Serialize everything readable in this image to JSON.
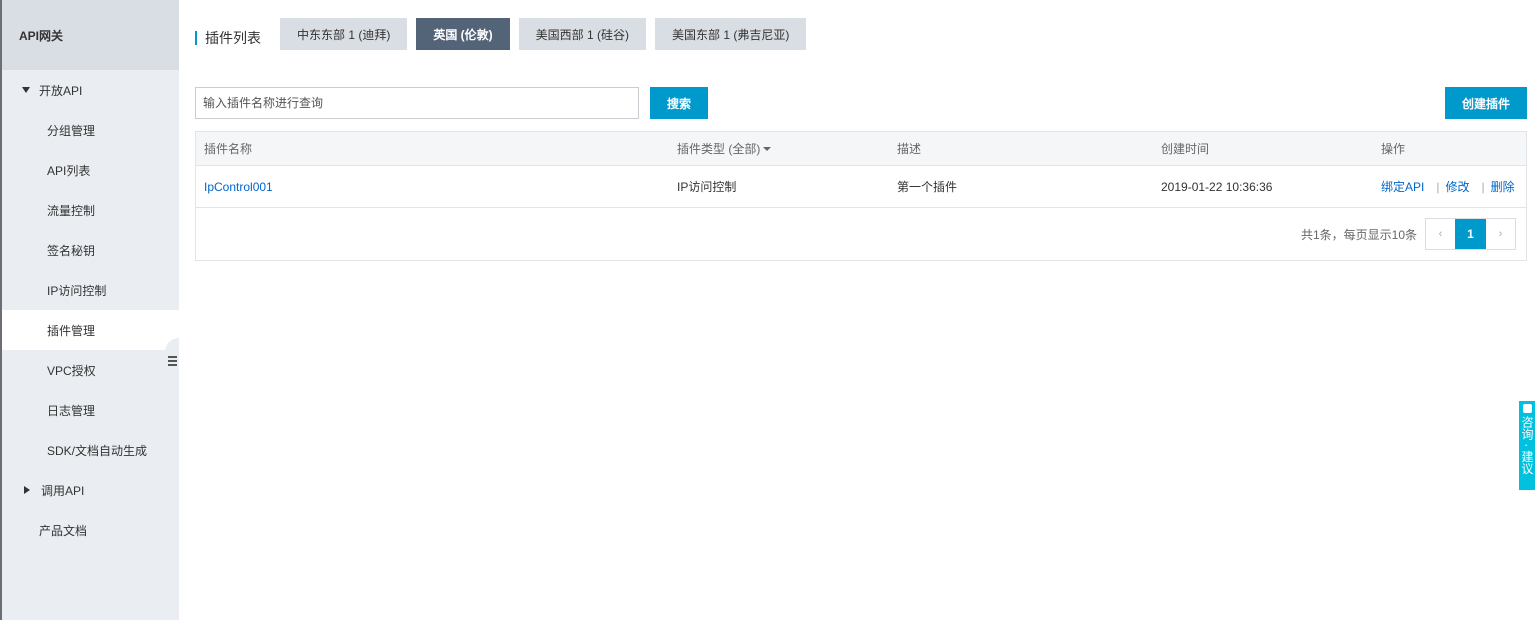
{
  "sidebar": {
    "title": "API网关",
    "section_open": "开放API",
    "items": [
      "分组管理",
      "API列表",
      "流量控制",
      "签名秘钥",
      "IP访问控制",
      "插件管理",
      "VPC授权",
      "日志管理",
      "SDK/文档自动生成"
    ],
    "active_item": "插件管理",
    "section_call": "调用API",
    "docs": "产品文档"
  },
  "page": {
    "title": "插件列表",
    "regions": [
      "中东东部 1 (迪拜)",
      "英国 (伦敦)",
      "美国西部 1 (硅谷)",
      "美国东部 1 (弗吉尼亚)"
    ],
    "active_region": "英国 (伦敦)"
  },
  "search": {
    "placeholder": "输入插件名称进行查询",
    "button": "搜索",
    "create_button": "创建插件"
  },
  "table": {
    "headers": [
      "插件名称",
      "插件类型 (全部)",
      "描述",
      "创建时间",
      "操作"
    ],
    "rows": [
      {
        "name": "IpControl001",
        "type": "IP访问控制",
        "description": "第一个插件",
        "created": "2019-01-22 10:36:36",
        "actions": [
          "绑定API",
          "修改",
          "删除"
        ]
      }
    ]
  },
  "pagination": {
    "summary": "共1条，每页显示10条",
    "prev": "‹",
    "current": "1",
    "next": "›"
  },
  "feedback": {
    "label": "咨询 · 建议"
  },
  "colors": {
    "accent": "#0099cc",
    "active_tab": "#546478",
    "link": "#0066cc",
    "feedback": "#00c1de"
  }
}
